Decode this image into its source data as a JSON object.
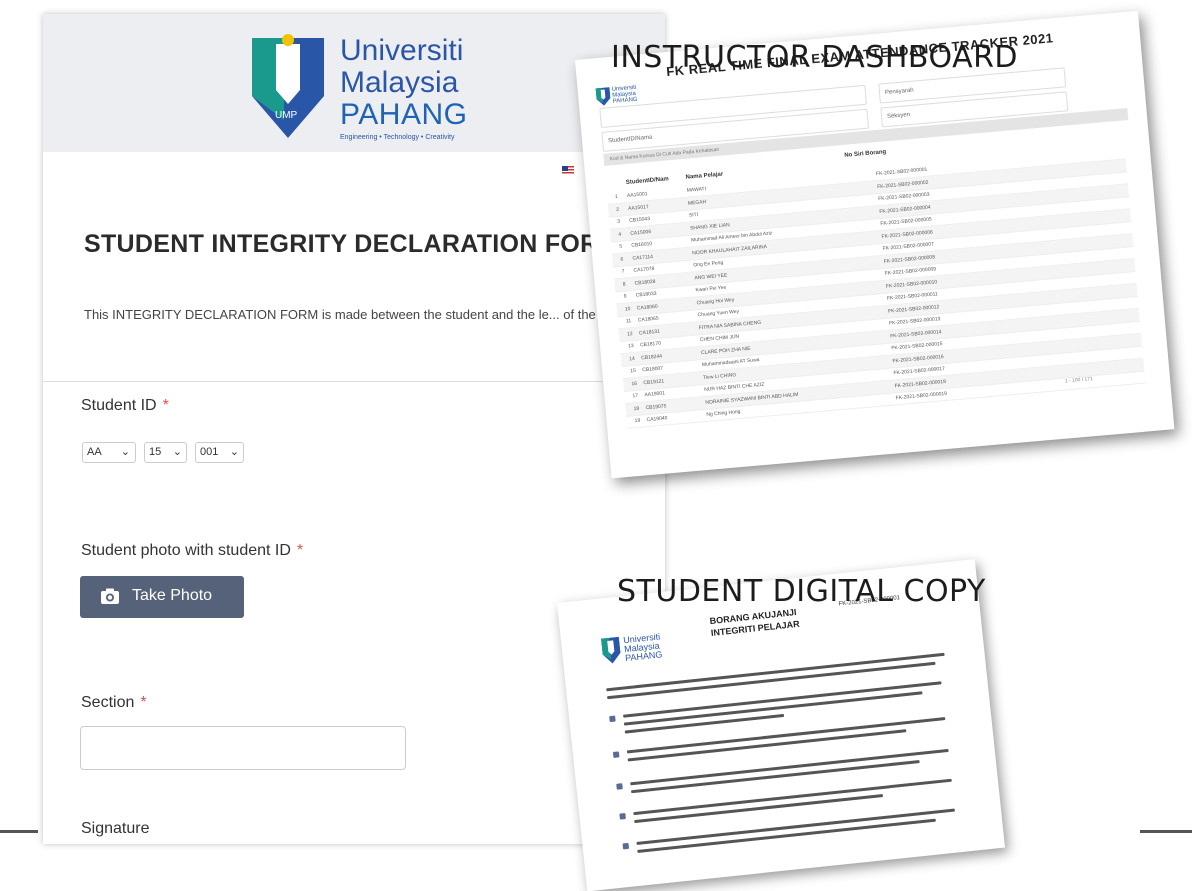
{
  "captions": {
    "dashboard": "INSTRUCTOR DASHBOARD",
    "digital_copy": "STUDENT DIGITAL COPY"
  },
  "logo": {
    "line1": "Universiti",
    "line2": "Malaysia",
    "line3": "PAHANG",
    "tagline": "Engineering • Technology • Creativity",
    "shield_text": "UMP"
  },
  "form": {
    "title": "STUDENT INTEGRITY DECLARATION FORM",
    "description": "This INTEGRITY DECLARATION FORM is made between the student and the le... of the course.",
    "fields": {
      "student_id": {
        "label": "Student ID",
        "required": "*",
        "selects": [
          "AA",
          "15",
          "001"
        ]
      },
      "photo": {
        "label": "Student photo with student ID",
        "required": "*",
        "button": "Take Photo"
      },
      "section": {
        "label": "Section",
        "required": "*",
        "value": ""
      },
      "signature": {
        "label": "Signature"
      }
    }
  },
  "dashboard": {
    "title": "FK REAL TIME FINAL EXAM ATTENDANCE TRACKER 2021",
    "fields": [
      "",
      "Pensyarah",
      "StudentID/Nama",
      "Seksyen"
    ],
    "bar_text": "Kod & Nama Kursus Di Cuti Ada Pada Kehabisan",
    "columns": [
      "",
      "StudentID/Nam",
      "Nama Pelajar",
      "No Siri Borang"
    ],
    "rows": [
      [
        "1",
        "AA15001",
        "MAWATI",
        "FK-2021-SB02-000001"
      ],
      [
        "2",
        "AA15017",
        "MEGAH",
        "FK-2021-SB02-000002"
      ],
      [
        "3",
        "CB15043",
        "SITI",
        "FK-2021-SB02-000003"
      ],
      [
        "4",
        "CA15006",
        "SHANG XIE LIAN",
        "FK-2021-SB02-000004"
      ],
      [
        "5",
        "CB16010",
        "Muhammad Ali Ameer bin Abdul Aziz",
        "FK-2021-SB02-000005"
      ],
      [
        "6",
        "CA17114",
        "NOOR KHAULAHAIT ZAILARINA",
        "FK-2021-SB02-000006"
      ],
      [
        "7",
        "CA17078",
        "Ong Ee Peng",
        "FK-2021-SB02-000007"
      ],
      [
        "8",
        "CB18028",
        "ANG WEI YEE",
        "FK-2021-SB02-000008"
      ],
      [
        "9",
        "CB18033",
        "Kwan Pei Yee",
        "FK-2021-SB02-000009"
      ],
      [
        "10",
        "CA18060",
        "Chuang Hoi Wey",
        "FK-2021-SB02-000010"
      ],
      [
        "11",
        "CA18065",
        "Chuang Yuen Wey",
        "FK-2021-SB02-000011"
      ],
      [
        "12",
        "CA18131",
        "FITRA NIA SABINA CHENG",
        "FK-2021-SB02-000012"
      ],
      [
        "13",
        "CB18170",
        "CHEN CHIM JUN",
        "FK-2021-SB02-000013"
      ],
      [
        "14",
        "CB18244",
        "CLARE POH ZHA NIE",
        "FK-2021-SB02-000014"
      ],
      [
        "15",
        "CB18007",
        "Muhammadsaini AT Suwa",
        "FK-2021-SB02-000015"
      ],
      [
        "16",
        "CB19121",
        "Tiew Li CHING",
        "FK-2021-SB02-000016"
      ],
      [
        "17",
        "AA19001",
        "NUR HAZ BINTI CHE AZIZ",
        "FK-2021-SB02-000017"
      ],
      [
        "18",
        "CB19075",
        "NORAINIE SYAZWANI BINTI ABD HALIM",
        "FK-2021-SB02-000018"
      ],
      [
        "19",
        "CA19040",
        "Ng Ching Hong",
        "FK-2021-SB02-000019"
      ]
    ],
    "pager": "1 - 100 / 171"
  },
  "digital_copy": {
    "title_line1": "BORANG AKUJANJI",
    "title_line2": "INTEGRITI PELAJAR",
    "ref": "FK-2021-SB02-000001",
    "logo_line1": "Universiti",
    "logo_line2": "Malaysia",
    "logo_line3": "PAHANG"
  },
  "colors": {
    "brand_blue": "#2a56a8",
    "brand_teal": "#1a9a8c",
    "button_gray": "#56627a",
    "required_red": "#d9534f"
  }
}
